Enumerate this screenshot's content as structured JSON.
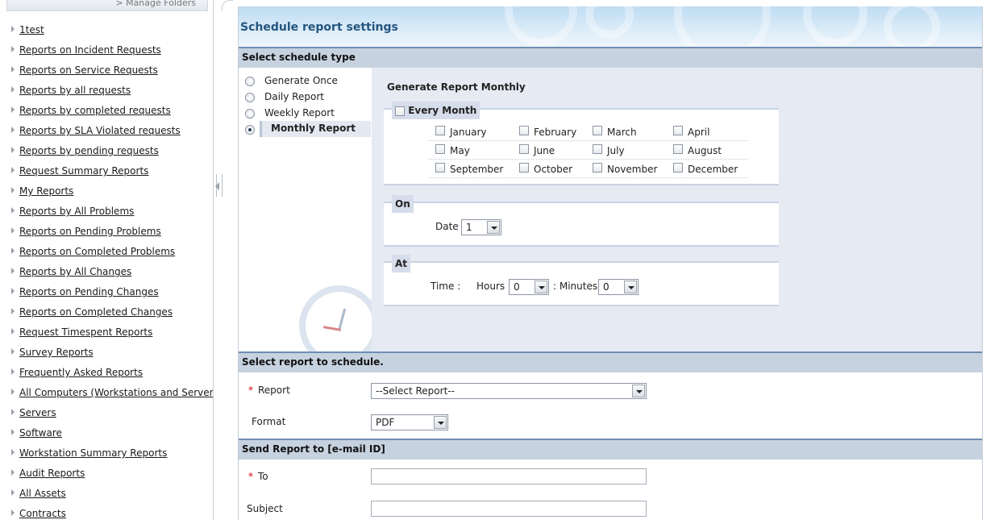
{
  "sidebar": {
    "manage_folders": "> Manage Folders",
    "items": [
      "1test",
      "Reports on Incident Requests",
      "Reports on Service Requests",
      "Reports by all requests",
      "Reports by completed requests",
      "Reports by SLA Violated requests",
      "Reports by pending requests",
      "Request Summary Reports",
      "My Reports",
      "Reports by All Problems",
      "Reports on Pending Problems",
      "Reports on Completed Problems",
      "Reports by All Changes",
      "Reports on Pending Changes",
      "Reports on Completed Changes",
      "Request Timespent Reports",
      "Survey Reports",
      "Frequently Asked Reports",
      "All Computers (Workstations and Servers)",
      "Servers",
      "Software",
      "Workstation Summary Reports",
      "Audit Reports",
      "All Assets",
      "Contracts"
    ]
  },
  "page": {
    "title": "Schedule report settings"
  },
  "schedule_type": {
    "header": "Select schedule type",
    "options": [
      {
        "label": "Generate Once",
        "checked": false
      },
      {
        "label": "Daily Report",
        "checked": false
      },
      {
        "label": "Weekly Report",
        "checked": false
      },
      {
        "label": "Monthly Report",
        "checked": true
      }
    ]
  },
  "monthly": {
    "title": "Generate Report Monthly",
    "every_month_label": "Every Month",
    "months": [
      [
        "January",
        "February",
        "March",
        "April"
      ],
      [
        "May",
        "June",
        "July",
        "August"
      ],
      [
        "September",
        "October",
        "November",
        "December"
      ]
    ],
    "on_label": "On",
    "date_label": "Date",
    "date_value": "1",
    "at_label": "At",
    "time_label": "Time :",
    "hours_label": "Hours",
    "hours_value": "0",
    "minutes_label": ": Minutes",
    "minutes_value": "0"
  },
  "report_section": {
    "header": "Select report to schedule.",
    "required_marker": "*",
    "report_label": "Report",
    "report_value": "--Select Report--",
    "format_label": "Format",
    "format_value": "PDF"
  },
  "email_section": {
    "header": "Send Report to [e-mail ID]",
    "required_marker": "*",
    "to_label": "To",
    "subject_label": "Subject"
  }
}
